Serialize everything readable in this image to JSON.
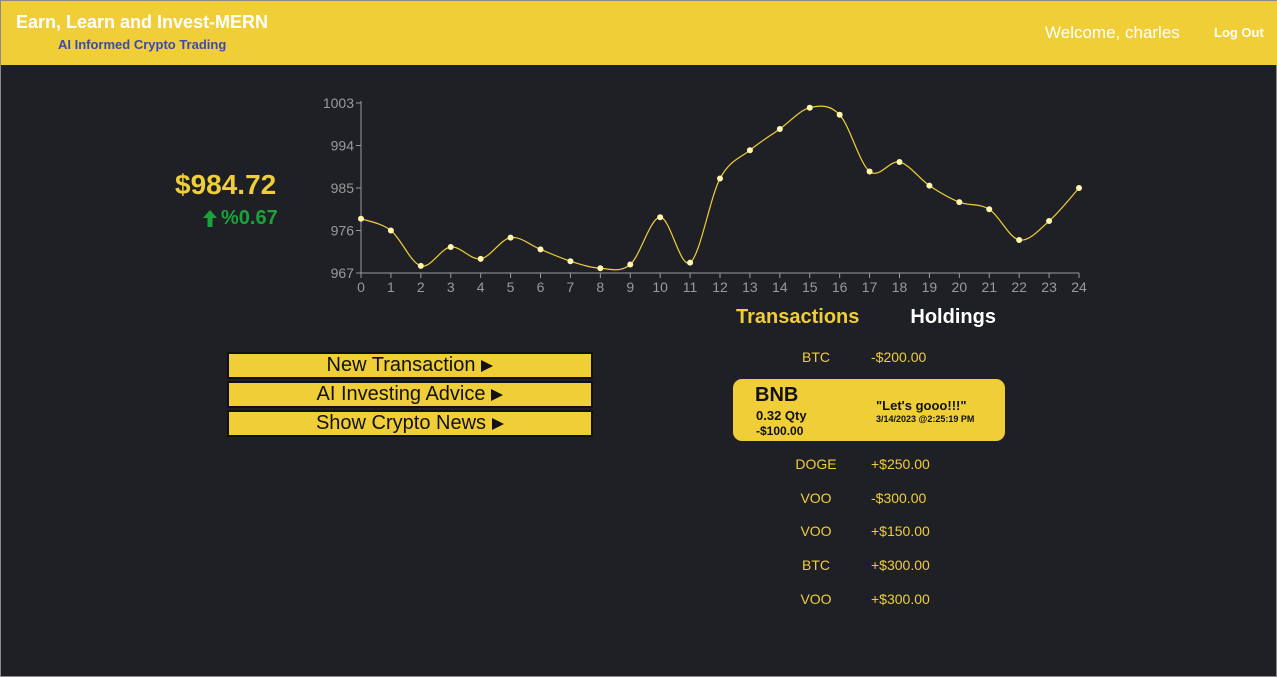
{
  "header": {
    "title": "Earn, Learn and Invest-MERN",
    "subtitle": "AI Informed Crypto Trading",
    "welcome": "Welcome, charles",
    "logout_label": "Log Out"
  },
  "summary": {
    "price": "$984.72",
    "change": "%0.67",
    "change_direction": "up",
    "up_color": "#1aa33a"
  },
  "colors": {
    "accent": "#f0ce38",
    "background": "#1e2025",
    "subtitle": "#3a4bb0"
  },
  "chart_data": {
    "type": "line",
    "x": [
      0,
      1,
      2,
      3,
      4,
      5,
      6,
      7,
      8,
      9,
      10,
      11,
      12,
      13,
      14,
      15,
      16,
      17,
      18,
      19,
      20,
      21,
      22,
      23,
      24
    ],
    "series": [
      {
        "values": [
          978.5,
          976.0,
          968.5,
          972.5,
          970.0,
          974.5,
          972.0,
          969.5,
          968.0,
          968.8,
          978.8,
          969.2,
          987.0,
          993.0,
          997.5,
          1002.0,
          1000.5,
          988.5,
          990.5,
          985.5,
          982.0,
          980.5,
          974.0,
          978.0,
          985.0
        ]
      }
    ],
    "yticks": [
      967,
      976,
      985,
      994,
      1003
    ],
    "ylim": [
      967,
      1003
    ],
    "xlim": [
      0,
      24
    ],
    "title": "",
    "xlabel": "",
    "ylabel": "",
    "grid": false,
    "line_color": "#f0ce38",
    "point_color": "#fff7b0"
  },
  "buttons": {
    "new_transaction": "New Transaction",
    "ai_advice": "AI Investing Advice",
    "crypto_news": "Show Crypto News"
  },
  "tabs": {
    "transactions": "Transactions",
    "holdings": "Holdings"
  },
  "transactions": {
    "before": [
      {
        "symbol": "BTC",
        "amount": "-$200.00"
      }
    ],
    "selected": {
      "symbol": "BNB",
      "qty": "0.32 Qty",
      "amount": "-$100.00",
      "note": "\"Let's gooo!!!\"",
      "date": "3/14/2023 @2:25:19 PM"
    },
    "after": [
      {
        "symbol": "DOGE",
        "amount": "+$250.00"
      },
      {
        "symbol": "VOO",
        "amount": "-$300.00"
      },
      {
        "symbol": "VOO",
        "amount": "+$150.00"
      },
      {
        "symbol": "BTC",
        "amount": "+$300.00"
      },
      {
        "symbol": "VOO",
        "amount": "+$300.00"
      }
    ]
  }
}
